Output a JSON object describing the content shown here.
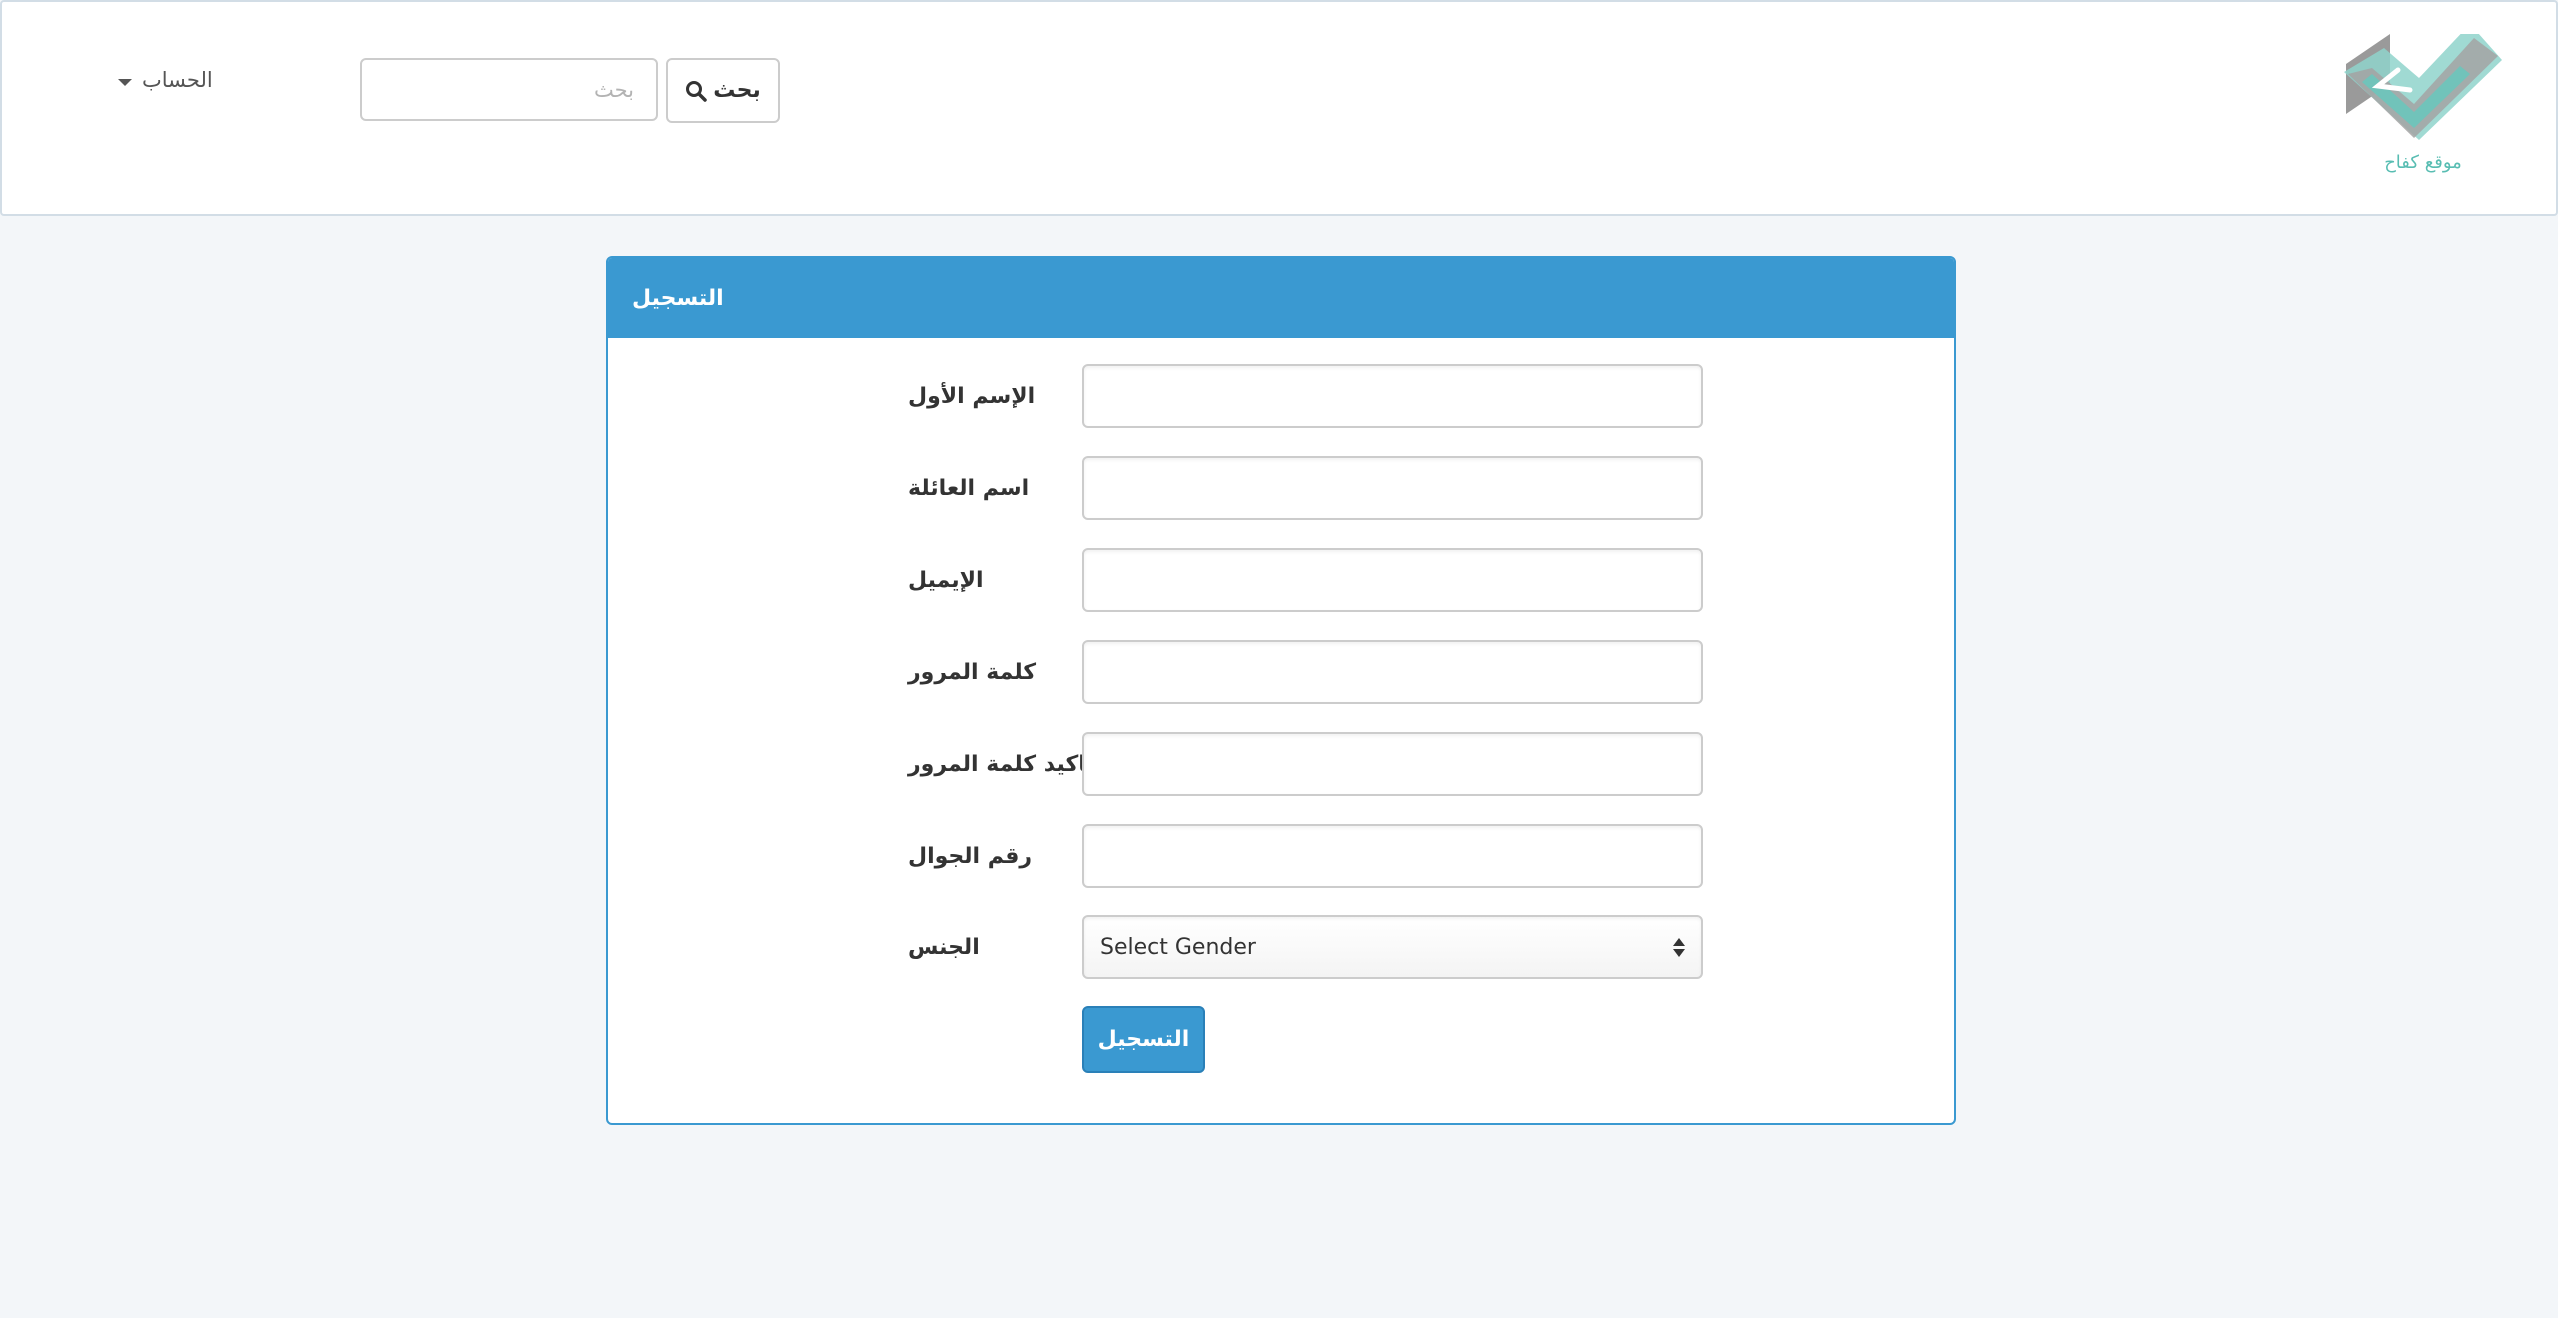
{
  "navbar": {
    "account_label": "الحساب",
    "search_placeholder": "بحث",
    "search_button_label": "بحث",
    "logo_caption": "موقع كفاح"
  },
  "form": {
    "title": "التسجيل",
    "fields": [
      {
        "label": "الإسم الأول",
        "value": ""
      },
      {
        "label": "اسم العائلة",
        "value": ""
      },
      {
        "label": "الإيميل",
        "value": ""
      },
      {
        "label": "كلمة المرور",
        "value": ""
      },
      {
        "label": "تاكيد كلمة المرور",
        "value": ""
      },
      {
        "label": "رقم الجوال",
        "value": ""
      }
    ],
    "gender": {
      "label": "الجنس",
      "selected": "Select Gender"
    },
    "submit_label": "التسجيل"
  },
  "colors": {
    "accent": "#3a99d1",
    "page_background": "#f3f6f9",
    "logo_teal": "#58bdb2",
    "logo_gray": "#9a9a9a"
  }
}
